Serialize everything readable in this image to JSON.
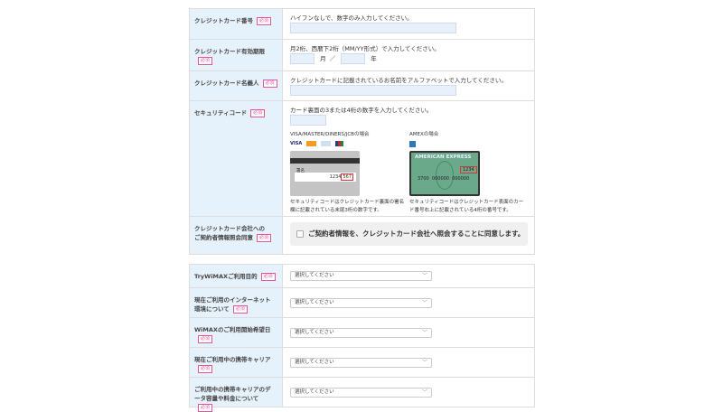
{
  "required_badge": "必須",
  "payment": {
    "card_number": {
      "label": "クレジットカード番号",
      "hint": "ハイフンなしで、数字のみ入力してください。",
      "value": ""
    },
    "expiry": {
      "label": "クレジットカード有効期限",
      "hint": "月2桁、西暦下2桁（MM/YY形式）で入力してください。",
      "month_unit": "月",
      "separator": "／",
      "year_unit": "年",
      "month": "",
      "year": ""
    },
    "holder": {
      "label": "クレジットカード名義人",
      "hint": "クレジットカードに記載されているお名前をアルファベットで入力してください。",
      "value": ""
    },
    "security": {
      "label": "セキュリティコード",
      "hint": "カード裏面の3または4桁の数字を入力してください。",
      "value": "",
      "visa_title": "VISA/MASTER/DINERS/JCBの場合",
      "visa_logo_text": "VISA",
      "sign_label": "署名",
      "sign_number": "1234",
      "sign_code": "567",
      "visa_caption": "セキュリティコードはクレジットカード裏面の署名欄に記載されている末尾3桁の数字です。",
      "amex_title": "AMEXの場合",
      "amex_brand": "AMERICAN EXPRESS",
      "amex_code": "1234",
      "amex_number": "3700  000000  000000",
      "amex_caption": "セキュリティコードはクレジットカード表面のカード番号右上に記載されている4桁の番号です。"
    },
    "consent": {
      "label_line1": "クレジットカード会社への",
      "label_line2": "ご契約者情報照会同意",
      "text": "ご契約者情報を、クレジットカード会社へ照会することに同意します。",
      "checked": false
    }
  },
  "survey": [
    {
      "label": "TryWiMAXご利用目的",
      "value": "選択してください"
    },
    {
      "label": "現在ご利用のインターネット環境について",
      "value": "選択してください"
    },
    {
      "label": "WiMAXのご利用開始希望日",
      "value": "選択してください"
    },
    {
      "label": "現在ご利用中の携帯キャリア",
      "value": "選択してください"
    },
    {
      "label": "ご利用中の携帯キャリアのデータ容量や料金について",
      "value": "選択してください"
    }
  ]
}
